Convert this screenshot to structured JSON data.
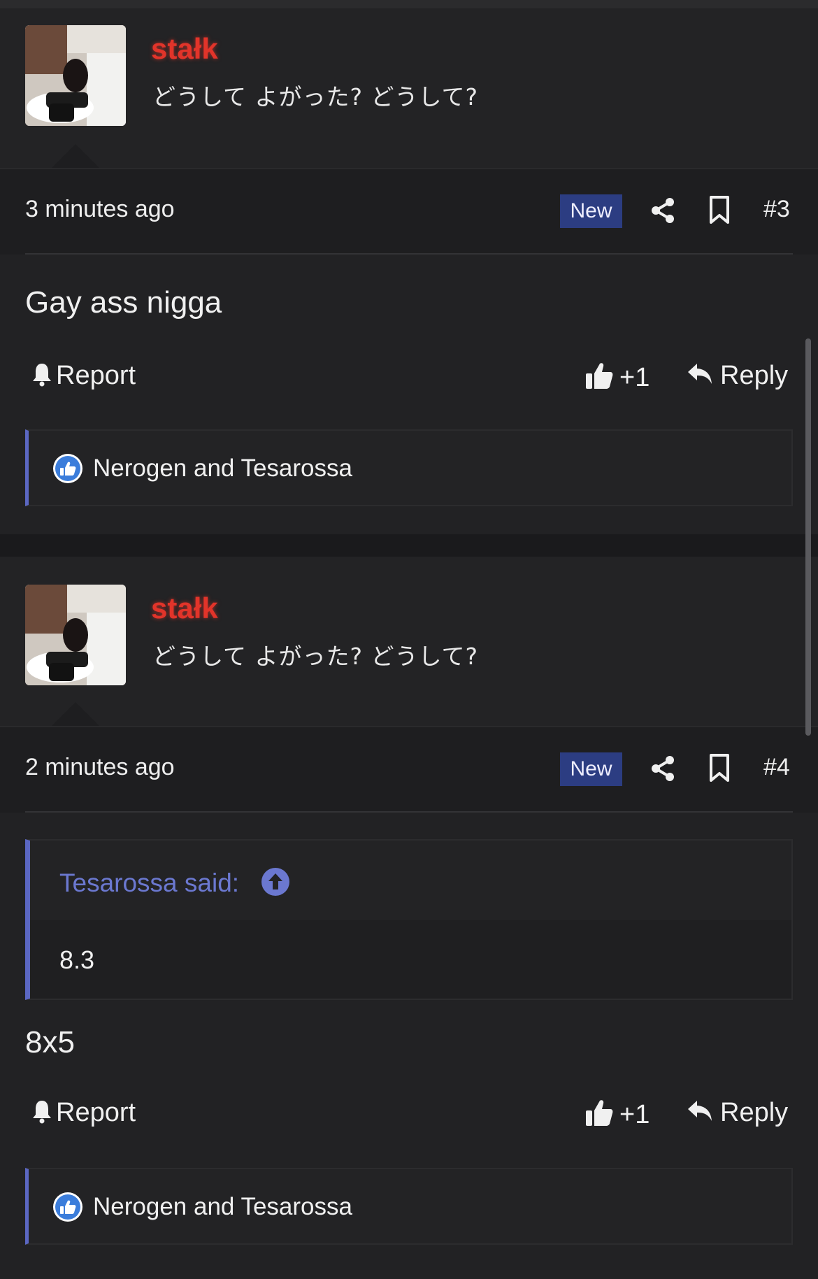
{
  "posts": [
    {
      "username": "stałk",
      "user_title": "どうして よがった?  どうして?",
      "time": "3 minutes ago",
      "badge": "New",
      "post_number": "#3",
      "body": "Gay ass nigga",
      "report_label": "Report",
      "like_label": "+1",
      "reply_label": "Reply",
      "likes_text": "Nerogen and Tesarossa"
    },
    {
      "username": "stałk",
      "user_title": "どうして よがった?  どうして?",
      "time": "2 minutes ago",
      "badge": "New",
      "post_number": "#4",
      "quote_author": "Tesarossa said:",
      "quote_text": "8.3",
      "body": "8x5",
      "report_label": "Report",
      "like_label": "+1",
      "reply_label": "Reply",
      "likes_text": "Nerogen and Tesarossa"
    }
  ],
  "colors": {
    "background": "#1a1a1c",
    "username": "#e2342a",
    "accent": "#5b67c2",
    "badge_new": "#2c3d82"
  },
  "icons": [
    "share-icon",
    "bookmark-icon",
    "bell-icon",
    "thumbs-up-icon",
    "reply-arrow-icon",
    "like-badge-icon",
    "arrow-up-circle-icon"
  ]
}
